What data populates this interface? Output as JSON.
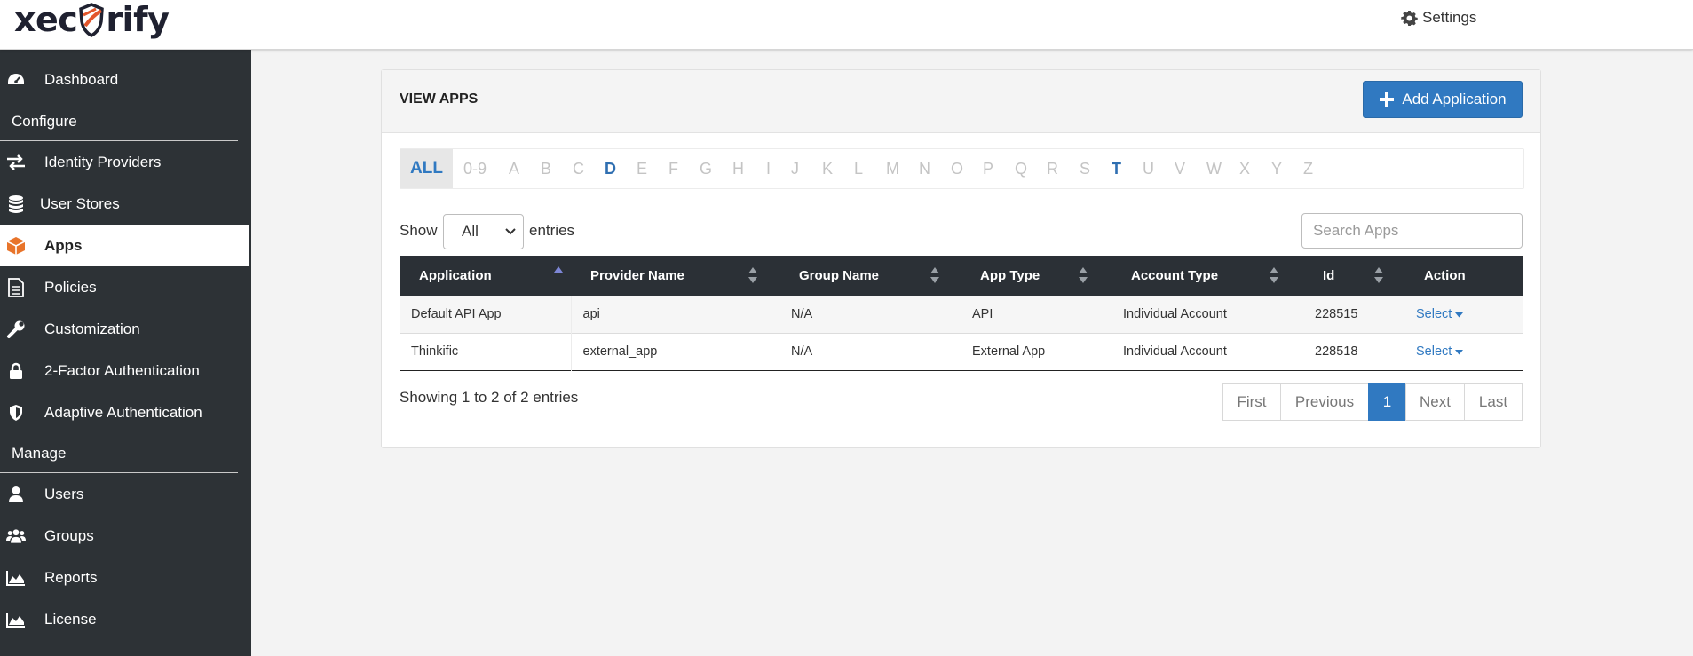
{
  "header": {
    "logo_left": "xec",
    "logo_right": "rify",
    "settings_label": "Settings"
  },
  "sidebar": {
    "items": [
      {
        "label": "Dashboard",
        "icon": "dashboard-icon"
      },
      {
        "label": "Identity Providers",
        "icon": "exchange-icon"
      },
      {
        "label": "User Stores",
        "icon": "database-icon"
      },
      {
        "label": "Apps",
        "icon": "cube-icon",
        "active": true
      },
      {
        "label": "Policies",
        "icon": "document-icon"
      },
      {
        "label": "Customization",
        "icon": "wrench-icon"
      },
      {
        "label": "2-Factor Authentication",
        "icon": "lock-icon"
      },
      {
        "label": "Adaptive Authentication",
        "icon": "shield-icon"
      },
      {
        "label": "Users",
        "icon": "user-icon"
      },
      {
        "label": "Groups",
        "icon": "users-icon"
      },
      {
        "label": "Reports",
        "icon": "area-chart-icon"
      },
      {
        "label": "License",
        "icon": "area-chart-icon"
      }
    ],
    "sections": {
      "configure": "Configure",
      "manage": "Manage"
    }
  },
  "panel": {
    "title": "VIEW APPS",
    "add_button": "Add Application"
  },
  "alphabet": {
    "all": "ALL",
    "letters": [
      "0-9",
      "A",
      "B",
      "C",
      "D",
      "E",
      "F",
      "G",
      "H",
      "I",
      "J",
      "K",
      "L",
      "M",
      "N",
      "O",
      "P",
      "Q",
      "R",
      "S",
      "T",
      "U",
      "V",
      "W",
      "X",
      "Y",
      "Z"
    ],
    "highlighted": [
      "D",
      "T"
    ]
  },
  "controls": {
    "show_label": "Show",
    "show_value": "All",
    "entries_label": "entries",
    "search_placeholder": "Search Apps"
  },
  "table": {
    "columns": [
      "Application",
      "Provider Name",
      "Group Name",
      "App Type",
      "Account Type",
      "Id",
      "Action"
    ],
    "rows": [
      {
        "application": "Default API App",
        "provider": "api",
        "group": "N/A",
        "app_type": "API",
        "account_type": "Individual Account",
        "id": "228515",
        "action": "Select"
      },
      {
        "application": "Thinkific",
        "provider": "external_app",
        "group": "N/A",
        "app_type": "External App",
        "account_type": "Individual Account",
        "id": "228518",
        "action": "Select"
      }
    ]
  },
  "footer": {
    "showing": "Showing 1 to 2 of 2 entries",
    "pager": {
      "first": "First",
      "previous": "Previous",
      "current": "1",
      "next": "Next",
      "last": "Last"
    }
  },
  "colors": {
    "accent": "#3079c1",
    "sidebar_bg": "#2d3236",
    "apps_icon": "#e8742a"
  }
}
